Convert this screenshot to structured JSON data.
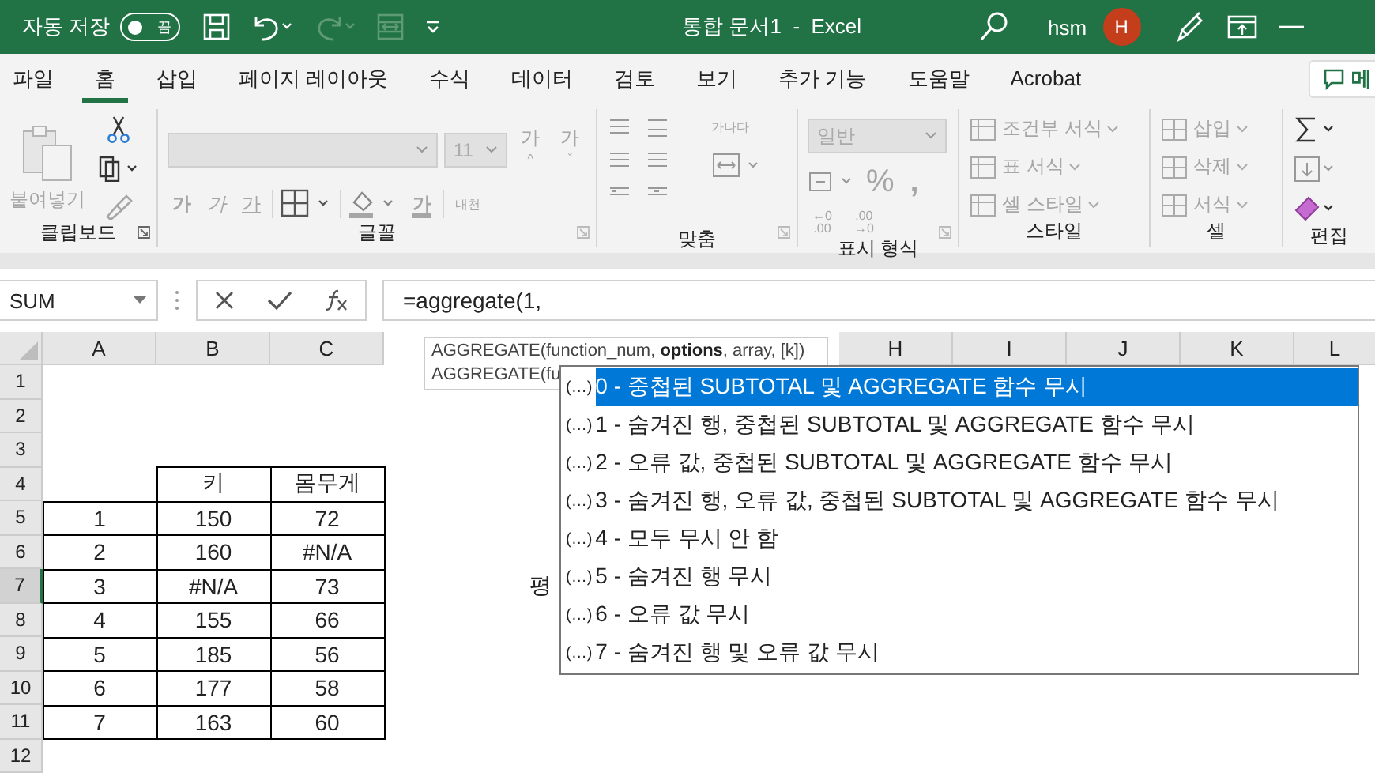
{
  "title_bar": {
    "autosave_label": "자동 저장",
    "autosave_toggle": {
      "on": false,
      "label": "끔"
    },
    "title": "통합 문서1  -  Excel",
    "user": "hsm",
    "avatar": "H"
  },
  "menu_tabs": [
    {
      "label": "파일",
      "selected": false
    },
    {
      "label": "홈",
      "selected": true
    },
    {
      "label": "삽입",
      "selected": false
    },
    {
      "label": "페이지 레이아웃",
      "selected": false
    },
    {
      "label": "수식",
      "selected": false
    },
    {
      "label": "데이터",
      "selected": false
    },
    {
      "label": "검토",
      "selected": false
    },
    {
      "label": "보기",
      "selected": false
    },
    {
      "label": "추가 기능",
      "selected": false
    },
    {
      "label": "도움말",
      "selected": false
    },
    {
      "label": "Acrobat",
      "selected": false
    }
  ],
  "comment_button": "메",
  "ribbon": {
    "clipboard": {
      "paste": "붙여넣기",
      "label": "클립보드"
    },
    "font": {
      "font_size": "11",
      "grow": "가",
      "grow_mark": "^",
      "shrink": "가",
      "shrink_mark": "ˇ",
      "style_buttons": [
        "가",
        "가",
        "가"
      ],
      "font_color": "가",
      "phonetic": "내천",
      "label": "글꼴"
    },
    "alignment": {
      "wrap": "가나다",
      "label": "맞춤"
    },
    "number": {
      "format": "일반",
      "percent": "%",
      "comma": ",",
      "decimal_increase": [
        "←0",
        ".00"
      ],
      "decimal_decrease": [
        ".00",
        "→0"
      ],
      "label": "표시 형식"
    },
    "styles": {
      "items": [
        "조건부 서식",
        "표 서식",
        "셀 스타일"
      ],
      "label": "스타일"
    },
    "cells": {
      "items": [
        "삽입",
        "삭제",
        "서식"
      ],
      "label": "셀"
    },
    "editing": {
      "label": "편집"
    }
  },
  "formula_bar": {
    "name_box": "SUM",
    "formula": "=aggregate(1,"
  },
  "sheet": {
    "columns": [
      "A",
      "B",
      "C",
      "H",
      "I",
      "J",
      "K",
      "L"
    ],
    "rows": [
      {
        "number": "1",
        "selected": false
      },
      {
        "number": "2",
        "selected": false
      },
      {
        "number": "3",
        "selected": false
      },
      {
        "number": "4",
        "selected": false
      },
      {
        "number": "5",
        "selected": false
      },
      {
        "number": "6",
        "selected": false
      },
      {
        "number": "7",
        "selected": true
      },
      {
        "number": "8",
        "selected": false
      },
      {
        "number": "9",
        "selected": false
      },
      {
        "number": "10",
        "selected": false
      },
      {
        "number": "11",
        "selected": false
      },
      {
        "number": "12",
        "selected": false
      }
    ],
    "table": {
      "header": [
        "키",
        "몸무게"
      ],
      "rows": [
        [
          "1",
          "150",
          "72"
        ],
        [
          "2",
          "160",
          "#N/A"
        ],
        [
          "3",
          "#N/A",
          "73"
        ],
        [
          "4",
          "155",
          "66"
        ],
        [
          "5",
          "185",
          "56"
        ],
        [
          "6",
          "177",
          "58"
        ],
        [
          "7",
          "163",
          "60"
        ]
      ]
    },
    "loose_cell": "평"
  },
  "tooltip": {
    "lines": [
      "AGGREGATE(function_num, **options**, array, [k])",
      "AGGREGATE(fu"
    ]
  },
  "autocomplete": [
    {
      "marker": "(…)",
      "label": "0 - 중첩된 SUBTOTAL 및 AGGREGATE 함수 무시",
      "selected": true
    },
    {
      "marker": "(…)",
      "label": "1 - 숨겨진 행, 중첩된 SUBTOTAL 및 AGGREGATE 함수 무시",
      "selected": false
    },
    {
      "marker": "(…)",
      "label": "2 - 오류 값, 중첩된 SUBTOTAL 및 AGGREGATE 함수 무시",
      "selected": false
    },
    {
      "marker": "(…)",
      "label": "3 - 숨겨진 행, 오류 값, 중첩된 SUBTOTAL 및 AGGREGATE 함수 무시",
      "selected": false
    },
    {
      "marker": "(…)",
      "label": "4 - 모두 무시 안 함",
      "selected": false
    },
    {
      "marker": "(…)",
      "label": "5 - 숨겨진 행 무시",
      "selected": false
    },
    {
      "marker": "(…)",
      "label": "6 - 오류 값 무시",
      "selected": false
    },
    {
      "marker": "(…)",
      "label": "7 - 숨겨진 행 및 오류 값 무시",
      "selected": false
    }
  ]
}
